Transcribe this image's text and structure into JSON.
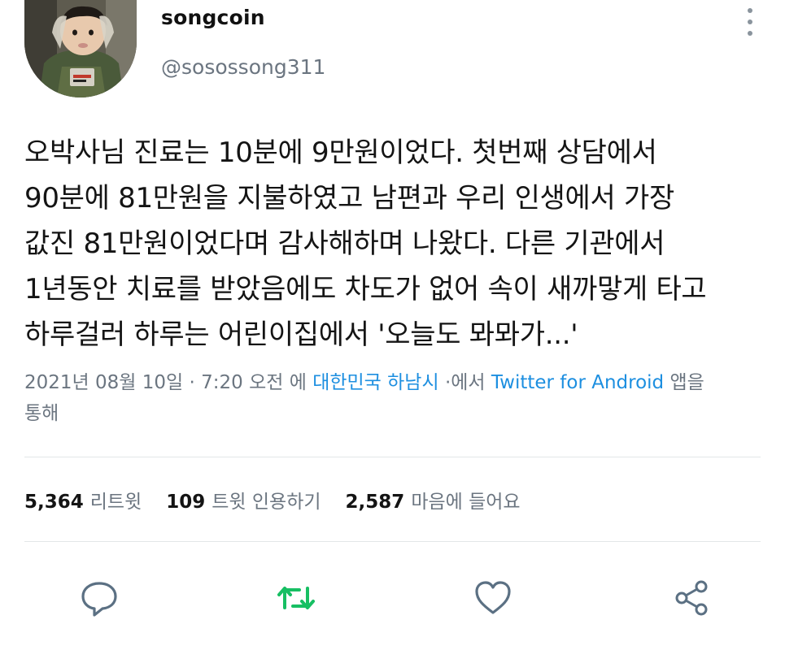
{
  "user": {
    "display_name": "songcoin",
    "handle": "@sosossong311",
    "avatar_icon": "avatar-photo"
  },
  "tweet": {
    "text": "오박사님 진료는 10분에 9만원이었다. 첫번째 상담에서\n90분에 81만원을 지불하였고 남편과 우리 인생에서 가장\n값진 81만원이었다며 감사해하며 나왔다. 다른 기관에서\n1년동안 치료를 받았음에도 차도가 없어 속이 새까맣게 타고\n하루걸러 하루는 어린이집에서 '오늘도 뫄뫄가...'"
  },
  "meta": {
    "date": "2021년 08월 10일",
    "separator": "·",
    "time": "7:20 오전",
    "location_prefix": "에",
    "location": "대한민국 하남시",
    "via_prefix": "·에서",
    "client": "Twitter for Android",
    "client_suffix": "앱을",
    "line2": "통해"
  },
  "stats": {
    "retweets": "5,364",
    "retweets_label": "리트윗",
    "quotes": "109",
    "quotes_label": "트윗 인용하기",
    "likes": "2,587",
    "likes_label": "마음에 들어요"
  },
  "actions": {
    "reply_icon": "reply-icon",
    "retweet_icon": "retweet-icon",
    "like_icon": "heart-icon",
    "share_icon": "share-icon"
  },
  "colors": {
    "accent": "#1d8fe0",
    "muted": "#6b7580",
    "retweet_green": "#17bf63",
    "icon_gray": "#5b7083"
  }
}
